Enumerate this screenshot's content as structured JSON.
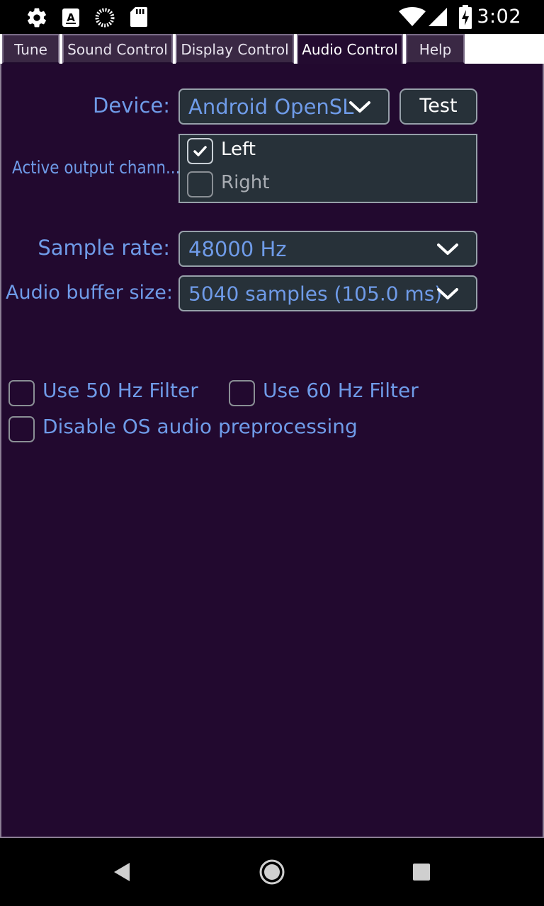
{
  "status_bar": {
    "time": "3:02",
    "left_icons": [
      "gear-icon",
      "keyboard-a-icon",
      "loading-circle-icon",
      "sd-card-icon"
    ],
    "right_icons": [
      "wifi-icon",
      "cell-signal-icon",
      "battery-charging-icon"
    ]
  },
  "tabs": [
    {
      "label": "Tune",
      "active": false
    },
    {
      "label": "Sound Control",
      "active": false
    },
    {
      "label": "Display Control",
      "active": false
    },
    {
      "label": "Audio Control",
      "active": true
    },
    {
      "label": "Help",
      "active": false
    }
  ],
  "audio": {
    "device_label": "Device:",
    "device_value": "Android OpenSL",
    "test_button": "Test",
    "channels_label": "Active output chann...",
    "channels": [
      {
        "label": "Left",
        "checked": true
      },
      {
        "label": "Right",
        "checked": false
      }
    ],
    "sample_rate_label": "Sample rate:",
    "sample_rate_value": "48000 Hz",
    "buffer_label": "Audio buffer size:",
    "buffer_value": "5040 samples (105.0 ms)",
    "options": [
      {
        "label": "Use 50 Hz Filter",
        "checked": false
      },
      {
        "label": "Use 60 Hz Filter",
        "checked": false
      },
      {
        "label": "Disable OS audio preprocessing",
        "checked": false
      }
    ]
  },
  "nav_bar": {
    "buttons": [
      "back-icon",
      "home-icon",
      "recents-icon"
    ]
  },
  "colors": {
    "background": "#22092f",
    "accent_text": "#6f9be8",
    "control_bg": "#273139",
    "tab_inactive": "#3a2844"
  }
}
